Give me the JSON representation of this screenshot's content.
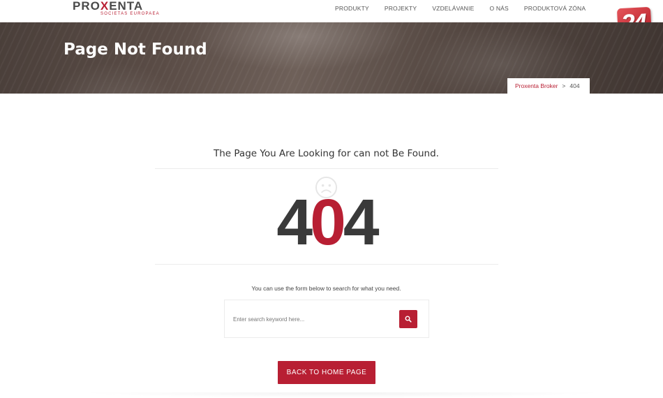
{
  "header": {
    "logo": {
      "main_prefix": "PRO",
      "main_x": "X",
      "main_suffix": "ENTA",
      "subtitle": "SOCIETAS EUROPAEA"
    },
    "nav": [
      {
        "label": "PRODUKTY"
      },
      {
        "label": "PROJEKTY"
      },
      {
        "label": "VZDELÁVANIE"
      },
      {
        "label": "O NÁS"
      },
      {
        "label": "PRODUKTOVÁ ZÓNA"
      }
    ],
    "badge": "24"
  },
  "banner": {
    "title": "Page Not Found",
    "breadcrumb": {
      "home": "Proxenta Broker",
      "separator": ">",
      "current": "404"
    }
  },
  "content": {
    "headline": "The Page You Are Looking for can not Be Found.",
    "error_code": {
      "first": "4",
      "middle": "0",
      "last": "4"
    },
    "hint": "You can use the form below to search for what you need.",
    "search": {
      "placeholder": "Enter search keyword here...",
      "value": ""
    },
    "home_button": "BACK TO HOME PAGE"
  },
  "colors": {
    "accent": "#b81f33",
    "dark_text": "#3a3a3a",
    "divider": "#ececec"
  },
  "icons": {
    "sad_face": "sad-face-icon",
    "search": "search-icon"
  }
}
